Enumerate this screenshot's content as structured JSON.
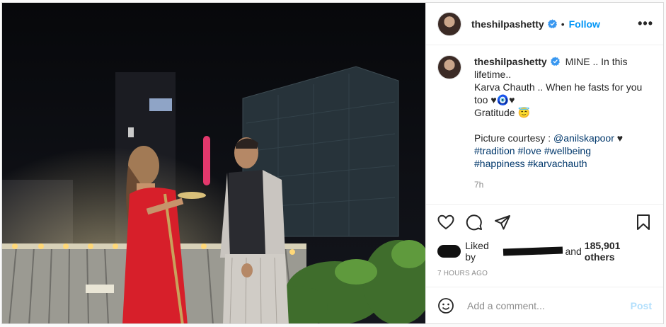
{
  "header": {
    "username": "theshilpashetty",
    "separator": "•",
    "follow_label": "Follow",
    "more_icon": "•••"
  },
  "caption": {
    "username": "theshilpashetty",
    "line1": "MINE .. In this",
    "line2": "lifetime..",
    "line3": "Karva Chauth .. When he fasts for you",
    "line4_text": "too",
    "line4_emoji": "♥🧿♥",
    "line5_text": "Gratitude",
    "line5_emoji": "😇",
    "credit_prefix": "Picture courtesy :",
    "credit_mention": "@anilskapoor",
    "credit_heart": "♥",
    "tags_line1": [
      "#tradition",
      "#love",
      "#wellbeing"
    ],
    "tags_line2": [
      "#happiness",
      "#karvachauth"
    ],
    "time_ago": "7h"
  },
  "likes": {
    "prefix": "Liked by",
    "middle": "and",
    "count_text": "185,901 others"
  },
  "post_time": "7 HOURS AGO",
  "comment_box": {
    "placeholder": "Add a comment...",
    "post_label": "Post"
  },
  "colors": {
    "accent": "#0095f6",
    "link": "#00376b",
    "post_disabled": "#b2dffc",
    "saree_red": "#d71f2a"
  }
}
